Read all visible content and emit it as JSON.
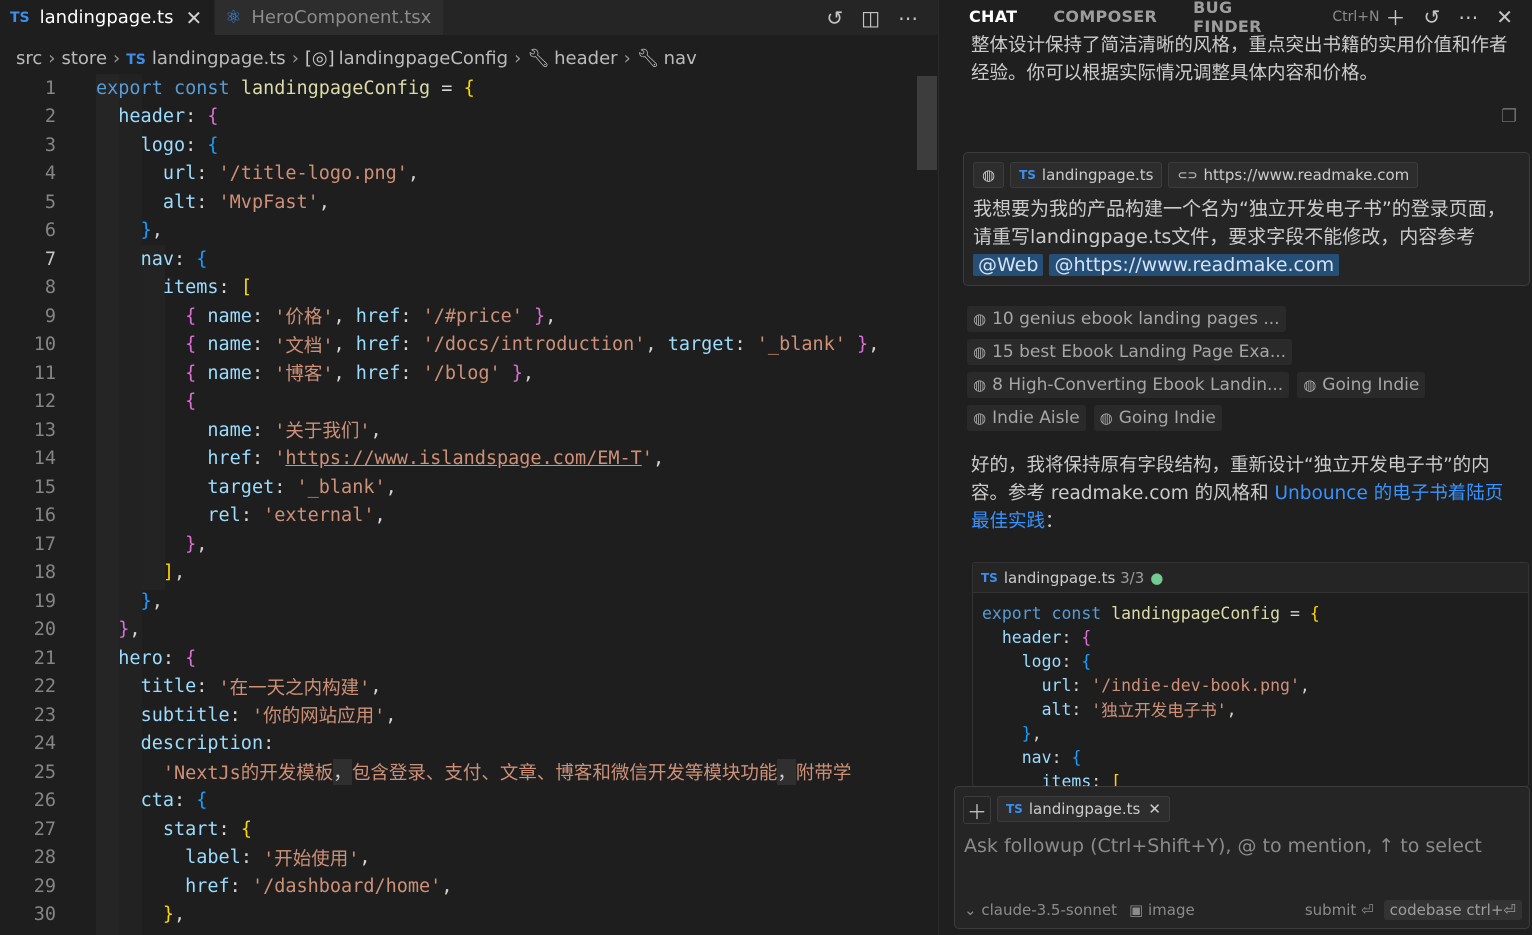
{
  "editor": {
    "tabs": [
      {
        "label": "landingpage.ts",
        "badge": "TS",
        "active": true
      },
      {
        "label": "HeroComponent.tsx",
        "badge": "react",
        "active": false
      }
    ],
    "breadcrumb": [
      "src",
      "store",
      "landingpage.ts",
      "landingpageConfig",
      "header",
      "nav"
    ],
    "breadcrumb_badge": "TS",
    "current_line": 7,
    "lines": [
      [
        [
          "k",
          "export"
        ],
        [
          "p",
          " "
        ],
        [
          "k",
          "const"
        ],
        [
          "p",
          " "
        ],
        [
          "f",
          "landingpageConfig"
        ],
        [
          "p",
          " = "
        ],
        [
          "b1",
          "{"
        ]
      ],
      [
        [
          "p",
          "  "
        ],
        [
          "prop",
          "header"
        ],
        [
          "p",
          ": "
        ],
        [
          "b2",
          "{"
        ]
      ],
      [
        [
          "p",
          "    "
        ],
        [
          "prop",
          "logo"
        ],
        [
          "p",
          ": "
        ],
        [
          "b3",
          "{"
        ]
      ],
      [
        [
          "p",
          "      "
        ],
        [
          "prop",
          "url"
        ],
        [
          "p",
          ": "
        ],
        [
          "s",
          "'/title-logo.png'"
        ],
        [
          "p",
          ","
        ]
      ],
      [
        [
          "p",
          "      "
        ],
        [
          "prop",
          "alt"
        ],
        [
          "p",
          ": "
        ],
        [
          "s",
          "'MvpFast'"
        ],
        [
          "p",
          ","
        ]
      ],
      [
        [
          "p",
          "    "
        ],
        [
          "b3",
          "}"
        ],
        [
          "p",
          ","
        ]
      ],
      [
        [
          "p",
          "    "
        ],
        [
          "prop",
          "nav"
        ],
        [
          "p",
          ": "
        ],
        [
          "b3",
          "{"
        ]
      ],
      [
        [
          "p",
          "      "
        ],
        [
          "prop",
          "items"
        ],
        [
          "p",
          ": "
        ],
        [
          "b1",
          "["
        ]
      ],
      [
        [
          "p",
          "        "
        ],
        [
          "b2",
          "{"
        ],
        [
          "p",
          " "
        ],
        [
          "prop",
          "name"
        ],
        [
          "p",
          ": "
        ],
        [
          "s",
          "'价格'"
        ],
        [
          "p",
          ", "
        ],
        [
          "prop",
          "href"
        ],
        [
          "p",
          ": "
        ],
        [
          "s",
          "'/#price'"
        ],
        [
          "p",
          " "
        ],
        [
          "b2",
          "}"
        ],
        [
          "p",
          ","
        ]
      ],
      [
        [
          "p",
          "        "
        ],
        [
          "b2",
          "{"
        ],
        [
          "p",
          " "
        ],
        [
          "prop",
          "name"
        ],
        [
          "p",
          ": "
        ],
        [
          "s",
          "'文档'"
        ],
        [
          "p",
          ", "
        ],
        [
          "prop",
          "href"
        ],
        [
          "p",
          ": "
        ],
        [
          "s",
          "'/docs/introduction'"
        ],
        [
          "p",
          ", "
        ],
        [
          "prop",
          "target"
        ],
        [
          "p",
          ": "
        ],
        [
          "s",
          "'_blank'"
        ],
        [
          "p",
          " "
        ],
        [
          "b2",
          "}"
        ],
        [
          "p",
          ","
        ]
      ],
      [
        [
          "p",
          "        "
        ],
        [
          "b2",
          "{"
        ],
        [
          "p",
          " "
        ],
        [
          "prop",
          "name"
        ],
        [
          "p",
          ": "
        ],
        [
          "s",
          "'博客'"
        ],
        [
          "p",
          ", "
        ],
        [
          "prop",
          "href"
        ],
        [
          "p",
          ": "
        ],
        [
          "s",
          "'/blog'"
        ],
        [
          "p",
          " "
        ],
        [
          "b2",
          "}"
        ],
        [
          "p",
          ","
        ]
      ],
      [
        [
          "p",
          "        "
        ],
        [
          "b2",
          "{"
        ]
      ],
      [
        [
          "p",
          "          "
        ],
        [
          "prop",
          "name"
        ],
        [
          "p",
          ": "
        ],
        [
          "s",
          "'关于我们'"
        ],
        [
          "p",
          ","
        ]
      ],
      [
        [
          "p",
          "          "
        ],
        [
          "prop",
          "href"
        ],
        [
          "p",
          ": "
        ],
        [
          "s",
          "'"
        ],
        [
          "su",
          "https://www.islandspage.com/EM-T"
        ],
        [
          "s",
          "'"
        ],
        [
          "p",
          ","
        ]
      ],
      [
        [
          "p",
          "          "
        ],
        [
          "prop",
          "target"
        ],
        [
          "p",
          ": "
        ],
        [
          "s",
          "'_blank'"
        ],
        [
          "p",
          ","
        ]
      ],
      [
        [
          "p",
          "          "
        ],
        [
          "prop",
          "rel"
        ],
        [
          "p",
          ": "
        ],
        [
          "s",
          "'external'"
        ],
        [
          "p",
          ","
        ]
      ],
      [
        [
          "p",
          "        "
        ],
        [
          "b2",
          "}"
        ],
        [
          "p",
          ","
        ]
      ],
      [
        [
          "p",
          "      "
        ],
        [
          "b1",
          "]"
        ],
        [
          "p",
          ","
        ]
      ],
      [
        [
          "p",
          "    "
        ],
        [
          "b3",
          "}"
        ],
        [
          "p",
          ","
        ]
      ],
      [
        [
          "p",
          "  "
        ],
        [
          "b2",
          "}"
        ],
        [
          "p",
          ","
        ]
      ],
      [
        [
          "p",
          "  "
        ],
        [
          "prop",
          "hero"
        ],
        [
          "p",
          ": "
        ],
        [
          "b2",
          "{"
        ]
      ],
      [
        [
          "p",
          "    "
        ],
        [
          "prop",
          "title"
        ],
        [
          "p",
          ": "
        ],
        [
          "s",
          "'在一天之内构建'"
        ],
        [
          "p",
          ","
        ]
      ],
      [
        [
          "p",
          "    "
        ],
        [
          "prop",
          "subtitle"
        ],
        [
          "p",
          ": "
        ],
        [
          "s",
          "'你的网站应用'"
        ],
        [
          "p",
          ","
        ]
      ],
      [
        [
          "p",
          "    "
        ],
        [
          "prop",
          "description"
        ],
        [
          "p",
          ":"
        ]
      ],
      [
        [
          "p",
          "      "
        ],
        [
          "s",
          "'NextJs的开发模板"
        ],
        [
          "hl",
          "，"
        ],
        [
          "s",
          "包含登录、支付、文章、博客和微信开发等模块功能"
        ],
        [
          "hl",
          "，"
        ],
        [
          "s",
          "附带学"
        ]
      ],
      [
        [
          "p",
          "    "
        ],
        [
          "prop",
          "cta"
        ],
        [
          "p",
          ": "
        ],
        [
          "b3",
          "{"
        ]
      ],
      [
        [
          "p",
          "      "
        ],
        [
          "prop",
          "start"
        ],
        [
          "p",
          ": "
        ],
        [
          "b1",
          "{"
        ]
      ],
      [
        [
          "p",
          "        "
        ],
        [
          "prop",
          "label"
        ],
        [
          "p",
          ": "
        ],
        [
          "s",
          "'开始使用'"
        ],
        [
          "p",
          ","
        ]
      ],
      [
        [
          "p",
          "        "
        ],
        [
          "prop",
          "href"
        ],
        [
          "p",
          ": "
        ],
        [
          "s",
          "'/dashboard/home'"
        ],
        [
          "p",
          ","
        ]
      ],
      [
        [
          "p",
          "      "
        ],
        [
          "b1",
          "}"
        ],
        [
          "p",
          ","
        ]
      ]
    ]
  },
  "panel": {
    "tabs": [
      "CHAT",
      "COMPOSER",
      "BUG FINDER"
    ],
    "active_tab": "CHAT",
    "new_chat_shortcut": "Ctrl+N",
    "prev_response": "整体设计保持了简洁清晰的风格，重点突出书籍的实用价值和作者经验。你可以根据实际情况调整具体内容和价格。",
    "query": {
      "chips": [
        "landingpage.ts",
        "https://www.readmake.com"
      ],
      "text": "我想要为我的产品构建一个名为“独立开发电子书”的登录页面，请重写landingpage.ts文件，要求字段不能修改，内容参考",
      "mentions": [
        "@Web",
        "@https://www.readmake.com"
      ]
    },
    "sources": [
      "10 genius ebook landing pages ...",
      "15 best Ebook Landing Page Exa...",
      "8 High-Converting Ebook Landin...",
      "Going Indie",
      "Indie Aisle",
      "Going Indie"
    ],
    "answer_text": "好的，我将保持原有字段结构，重新设计“独立开发电子书”的内容。参考 readmake.com 的风格和 ",
    "answer_link": "Unbounce 的电子书着陆页最佳实践",
    "answer_tail": "：",
    "codeblock": {
      "filename": "landingpage.ts",
      "counter": "3/3",
      "lines": [
        [
          [
            "k",
            "export"
          ],
          [
            "p",
            " "
          ],
          [
            "k",
            "const"
          ],
          [
            "p",
            " "
          ],
          [
            "f",
            "landingpageConfig"
          ],
          [
            "p",
            " = "
          ],
          [
            "b1",
            "{"
          ]
        ],
        [
          [
            "p",
            "  "
          ],
          [
            "prop",
            "header"
          ],
          [
            "p",
            ": "
          ],
          [
            "b2",
            "{"
          ]
        ],
        [
          [
            "p",
            "    "
          ],
          [
            "prop",
            "logo"
          ],
          [
            "p",
            ": "
          ],
          [
            "b3",
            "{"
          ]
        ],
        [
          [
            "p",
            "      "
          ],
          [
            "prop",
            "url"
          ],
          [
            "p",
            ": "
          ],
          [
            "s",
            "'/indie-dev-book.png'"
          ],
          [
            "p",
            ","
          ]
        ],
        [
          [
            "p",
            "      "
          ],
          [
            "prop",
            "alt"
          ],
          [
            "p",
            ": "
          ],
          [
            "s",
            "'独立开发电子书'"
          ],
          [
            "p",
            ","
          ]
        ],
        [
          [
            "p",
            "    "
          ],
          [
            "b3",
            "}"
          ],
          [
            "p",
            ","
          ]
        ],
        [
          [
            "p",
            "    "
          ],
          [
            "prop",
            "nav"
          ],
          [
            "p",
            ": "
          ],
          [
            "b3",
            "{"
          ]
        ],
        [
          [
            "p",
            "      "
          ],
          [
            "prop",
            "items"
          ],
          [
            "p",
            ": "
          ],
          [
            "b1",
            "["
          ]
        ]
      ]
    },
    "followup": {
      "chip": "landingpage.ts",
      "placeholder": "Ask followup (Ctrl+Shift+Y), @ to mention, ↑ to select",
      "model": "claude-3.5-sonnet",
      "image_label": "image",
      "submit_label": "submit",
      "codebase_label": "codebase",
      "codebase_shortcut": "ctrl+⏎"
    }
  },
  "colors": {
    "accent": "#3794ff",
    "ts_badge": "#3b8eea",
    "string": "#ce9178",
    "property": "#9cdcfe",
    "keyword": "#569cd6"
  }
}
